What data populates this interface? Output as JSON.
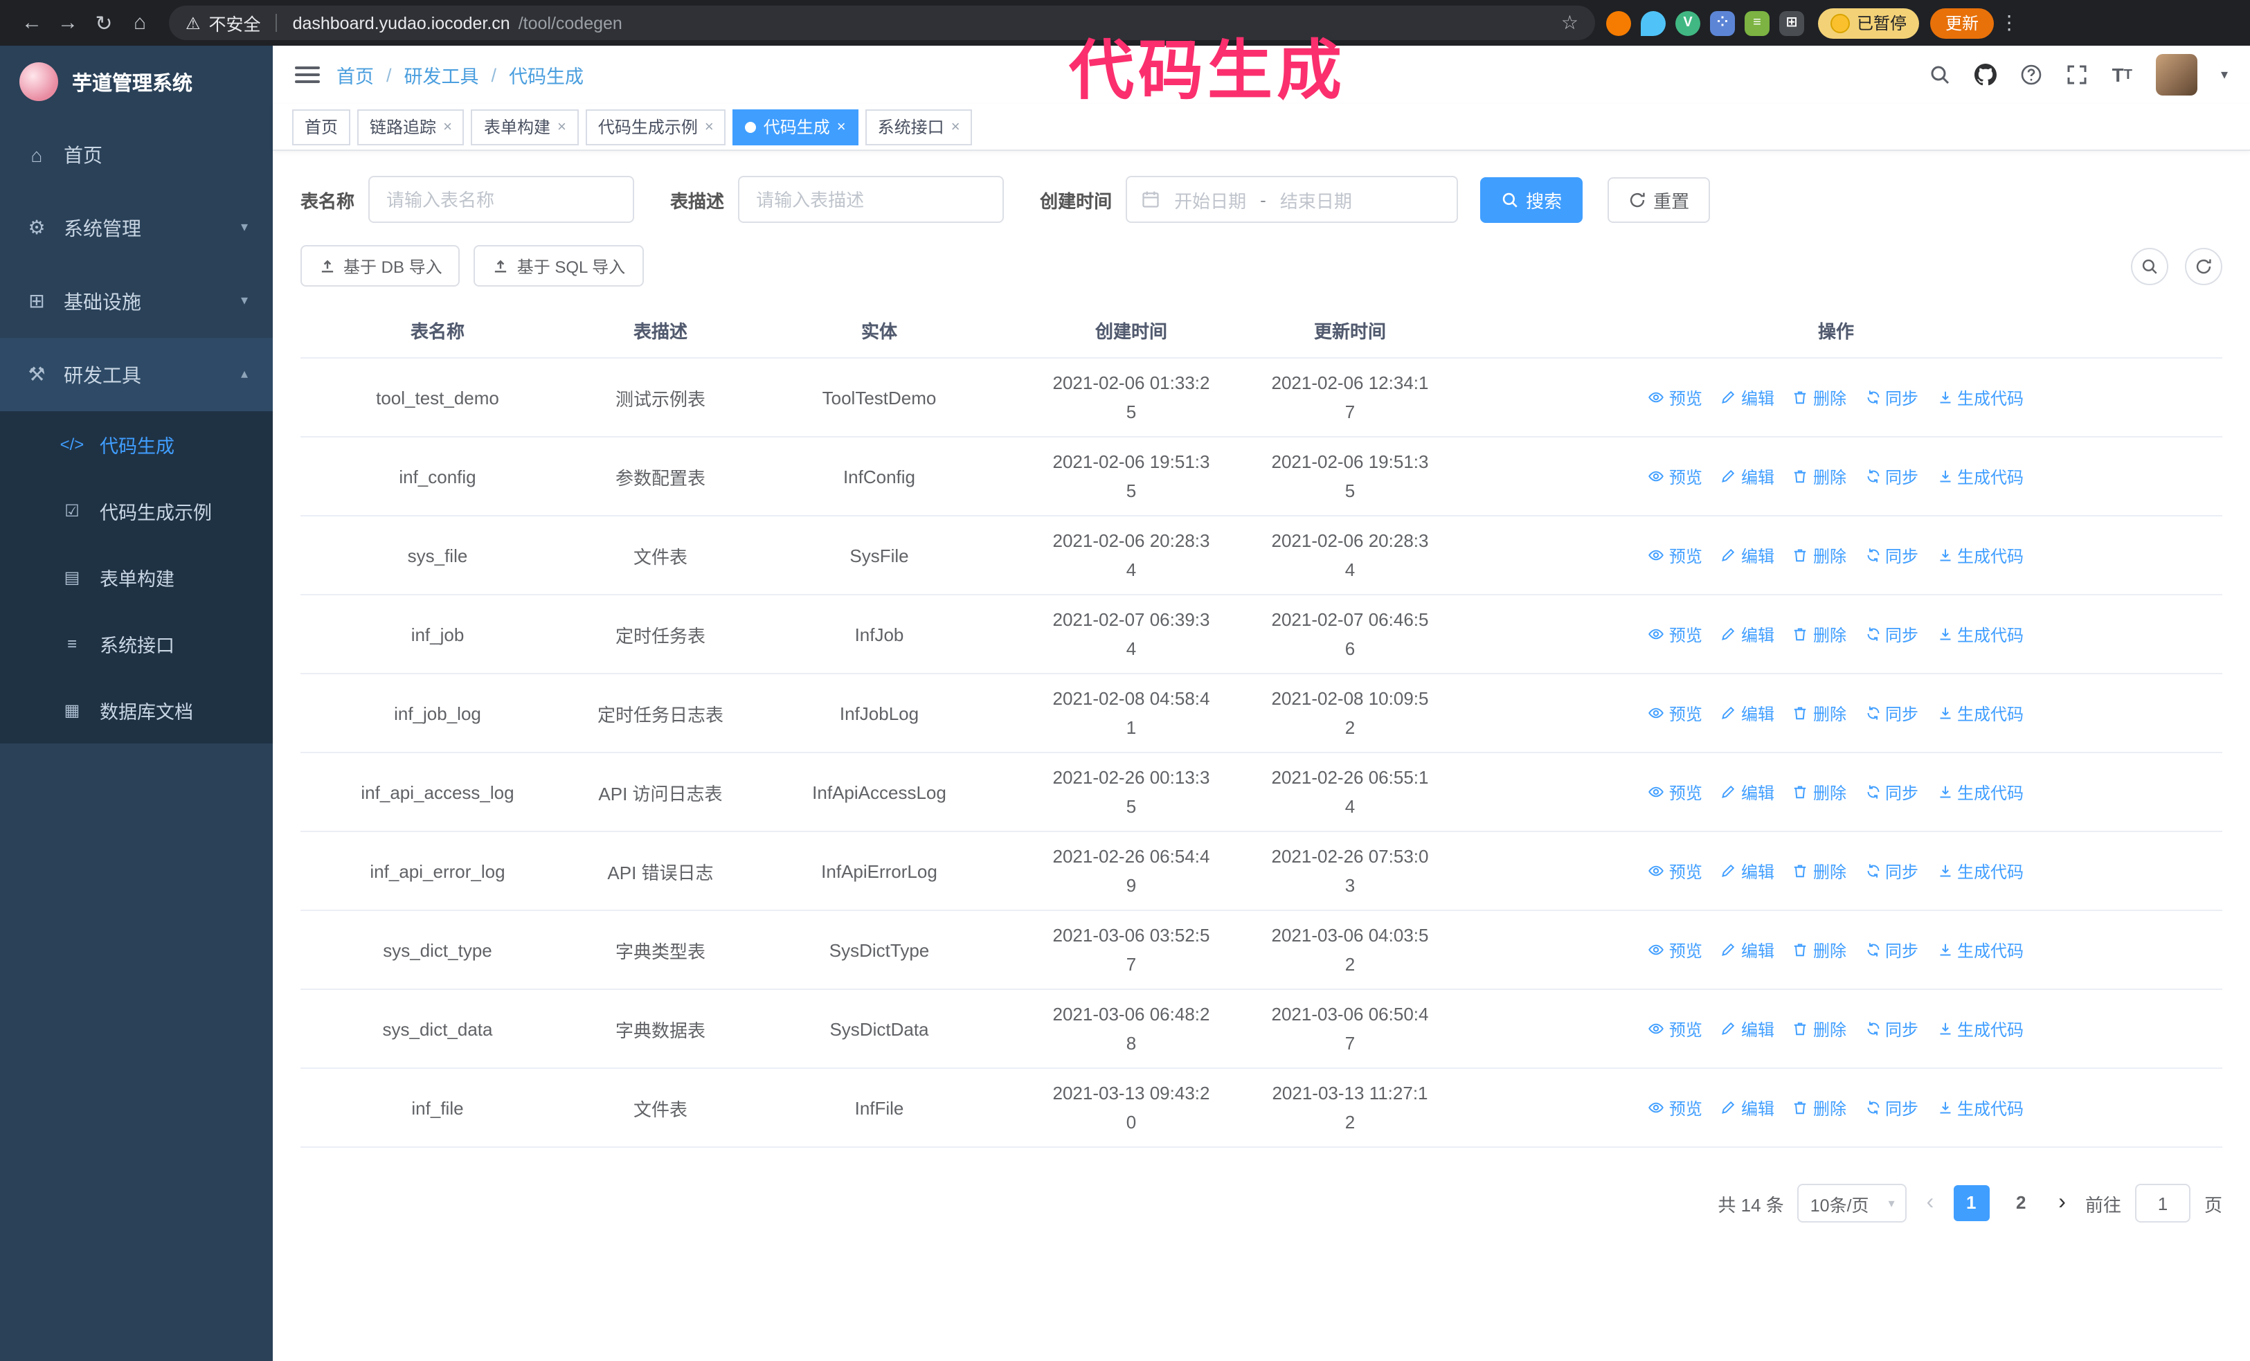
{
  "browser": {
    "security_label": "不安全",
    "url_host": "dashboard.yudao.iocoder.cn",
    "url_path": "/tool/codegen",
    "paused_badge": "已暂停",
    "update_button": "更新"
  },
  "annotation": "代码生成",
  "colors": {
    "accent": "#409eff",
    "annotation_pink": "#fb2f6d",
    "sidebar_bg": "#2a4158",
    "submenu_bg": "#1f3244",
    "update_button_bg": "#e8710a"
  },
  "sidebar": {
    "app_title": "芋道管理系统",
    "items": [
      {
        "label": "首页"
      },
      {
        "label": "系统管理"
      },
      {
        "label": "基础设施"
      },
      {
        "label": "研发工具"
      }
    ],
    "subitems": [
      {
        "label": "代码生成",
        "active": true
      },
      {
        "label": "代码生成示例",
        "active": false
      },
      {
        "label": "表单构建",
        "active": false
      },
      {
        "label": "系统接口",
        "active": false
      },
      {
        "label": "数据库文档",
        "active": false
      }
    ]
  },
  "header": {
    "breadcrumb": [
      "首页",
      "研发工具",
      "代码生成"
    ]
  },
  "tabs": [
    {
      "label": "首页",
      "closable": false,
      "active": false
    },
    {
      "label": "链路追踪",
      "closable": true,
      "active": false
    },
    {
      "label": "表单构建",
      "closable": true,
      "active": false
    },
    {
      "label": "代码生成示例",
      "closable": true,
      "active": false
    },
    {
      "label": "代码生成",
      "closable": true,
      "active": true
    },
    {
      "label": "系统接口",
      "closable": true,
      "active": false
    }
  ],
  "filters": {
    "table_name_label": "表名称",
    "table_name_placeholder": "请输入表名称",
    "table_desc_label": "表描述",
    "table_desc_placeholder": "请输入表描述",
    "create_time_label": "创建时间",
    "date_start_placeholder": "开始日期",
    "date_separator": "-",
    "date_end_placeholder": "结束日期",
    "search_button": "搜索",
    "reset_button": "重置"
  },
  "toolbar": {
    "import_db": "基于 DB 导入",
    "import_sql": "基于 SQL 导入"
  },
  "table": {
    "columns": [
      "表名称",
      "表描述",
      "实体",
      "创建时间",
      "更新时间",
      "操作"
    ],
    "actions": [
      "预览",
      "编辑",
      "删除",
      "同步",
      "生成代码"
    ],
    "rows": [
      {
        "name": "tool_test_demo",
        "desc": "测试示例表",
        "entity": "ToolTestDemo",
        "created": "2021-02-06 01:33:25",
        "updated": "2021-02-06 12:34:17"
      },
      {
        "name": "inf_config",
        "desc": "参数配置表",
        "entity": "InfConfig",
        "created": "2021-02-06 19:51:35",
        "updated": "2021-02-06 19:51:35"
      },
      {
        "name": "sys_file",
        "desc": "文件表",
        "entity": "SysFile",
        "created": "2021-02-06 20:28:34",
        "updated": "2021-02-06 20:28:34"
      },
      {
        "name": "inf_job",
        "desc": "定时任务表",
        "entity": "InfJob",
        "created": "2021-02-07 06:39:34",
        "updated": "2021-02-07 06:46:56"
      },
      {
        "name": "inf_job_log",
        "desc": "定时任务日志表",
        "entity": "InfJobLog",
        "created": "2021-02-08 04:58:41",
        "updated": "2021-02-08 10:09:52"
      },
      {
        "name": "inf_api_access_log",
        "desc": "API 访问日志表",
        "entity": "InfApiAccessLog",
        "created": "2021-02-26 00:13:35",
        "updated": "2021-02-26 06:55:14"
      },
      {
        "name": "inf_api_error_log",
        "desc": "API 错误日志",
        "entity": "InfApiErrorLog",
        "created": "2021-02-26 06:54:49",
        "updated": "2021-02-26 07:53:03"
      },
      {
        "name": "sys_dict_type",
        "desc": "字典类型表",
        "entity": "SysDictType",
        "created": "2021-03-06 03:52:57",
        "updated": "2021-03-06 04:03:52"
      },
      {
        "name": "sys_dict_data",
        "desc": "字典数据表",
        "entity": "SysDictData",
        "created": "2021-03-06 06:48:28",
        "updated": "2021-03-06 06:50:47"
      },
      {
        "name": "inf_file",
        "desc": "文件表",
        "entity": "InfFile",
        "created": "2021-03-13 09:43:20",
        "updated": "2021-03-13 11:27:12"
      }
    ]
  },
  "pagination": {
    "total": "共 14 条",
    "page_size": "10条/页",
    "pages": [
      "1",
      "2"
    ],
    "active_page": "1",
    "goto_label": "前往",
    "goto_value": "1",
    "page_suffix": "页"
  }
}
